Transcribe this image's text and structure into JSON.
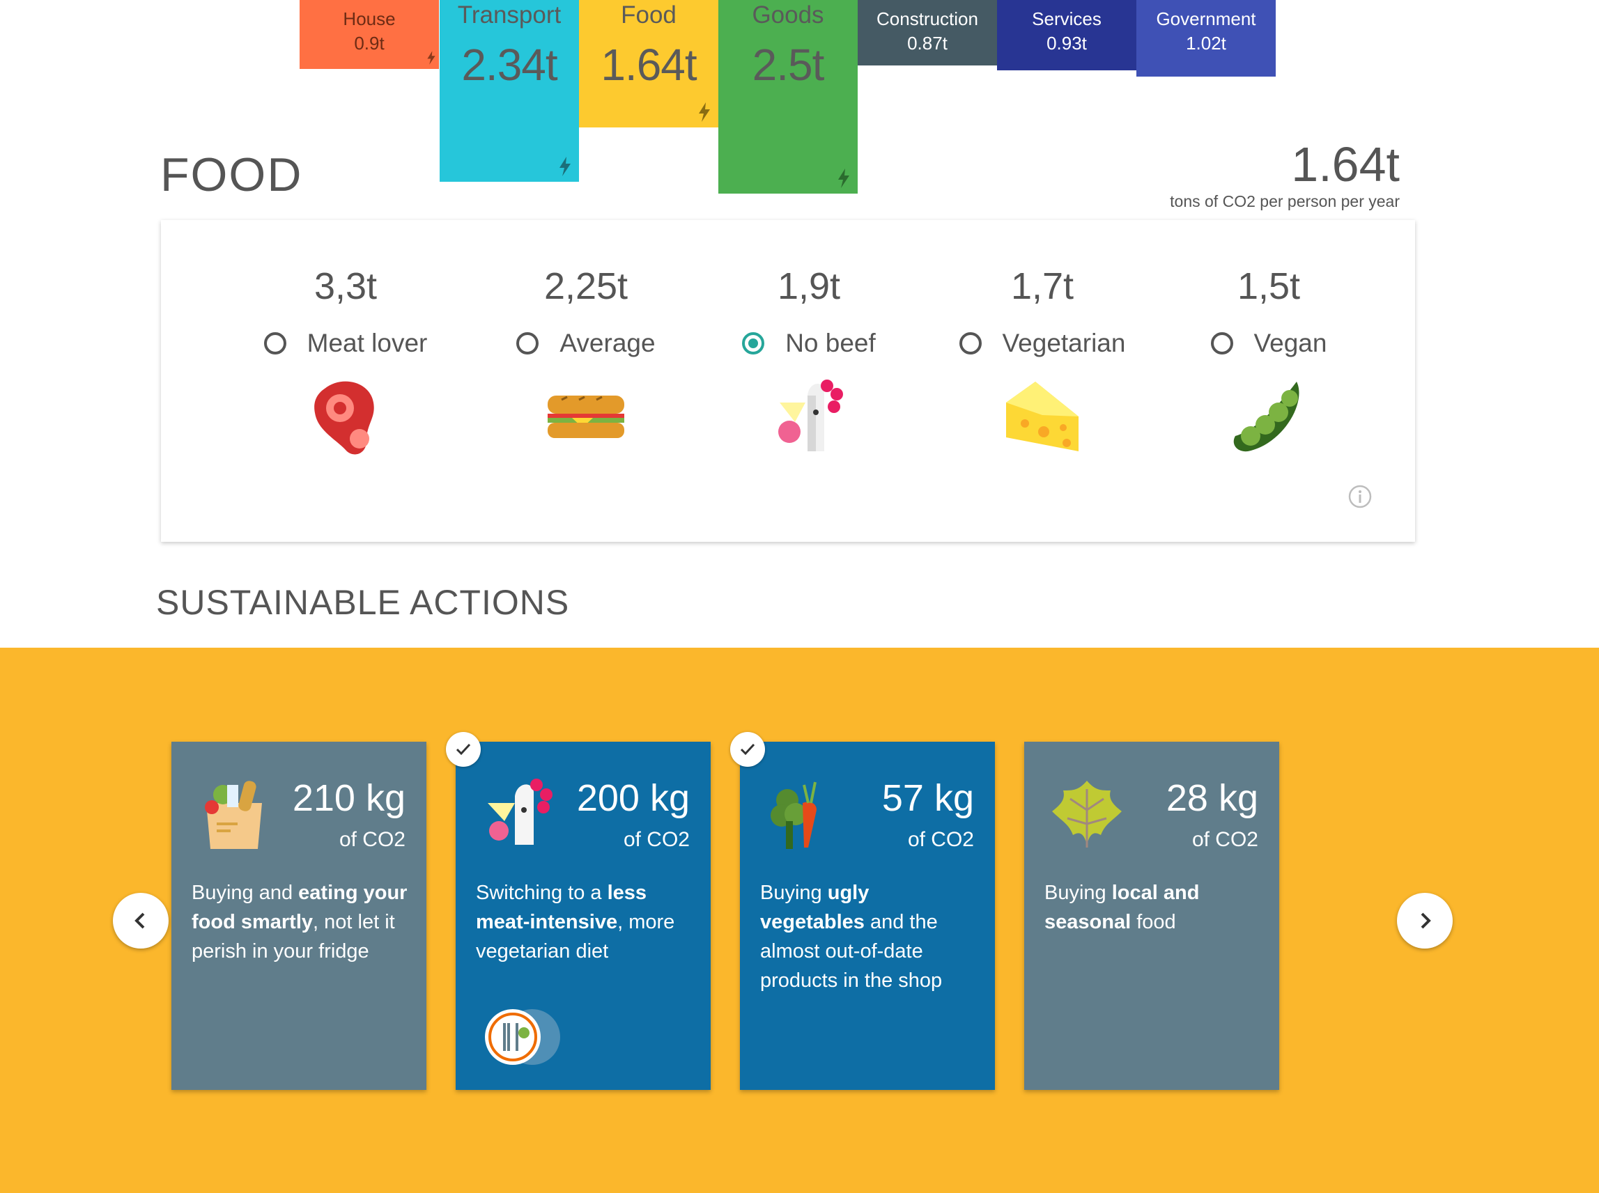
{
  "categories": [
    {
      "id": "house",
      "name": "House",
      "value": "0.9t"
    },
    {
      "id": "transport",
      "name": "Transport",
      "value": "2.34t"
    },
    {
      "id": "food",
      "name": "Food",
      "value": "1.64t"
    },
    {
      "id": "goods",
      "name": "Goods",
      "value": "2.5t"
    },
    {
      "id": "construction",
      "name": "Construction",
      "value": "0.87t"
    },
    {
      "id": "services",
      "name": "Services",
      "value": "0.93t"
    },
    {
      "id": "government",
      "name": "Government",
      "value": "1.02t"
    }
  ],
  "section": {
    "title": "FOOD",
    "total_value": "1.64t",
    "total_unit": "tons of CO2 per person per year"
  },
  "diets": [
    {
      "amount": "3,3t",
      "label": "Meat lover",
      "selected": false,
      "icon": "steak-icon"
    },
    {
      "amount": "2,25t",
      "label": "Average",
      "selected": false,
      "icon": "sandwich-icon"
    },
    {
      "amount": "1,9t",
      "label": "No beef",
      "selected": true,
      "icon": "chicken-icon"
    },
    {
      "amount": "1,7t",
      "label": "Vegetarian",
      "selected": false,
      "icon": "cheese-icon"
    },
    {
      "amount": "1,5t",
      "label": "Vegan",
      "selected": false,
      "icon": "peas-icon"
    }
  ],
  "actions_title": "SUSTAINABLE ACTIONS",
  "actions": [
    {
      "amount": "210 kg",
      "unit": "of CO2",
      "pre": "Buying and ",
      "bold": "eating your food smartly",
      "post": ", not let it perish in your fridge",
      "checked": false,
      "icon": "grocery-bag-icon"
    },
    {
      "amount": "200 kg",
      "unit": "of CO2",
      "pre": "Switching to a ",
      "bold": "less meat-intensive",
      "post": ", more vegetarian diet",
      "checked": true,
      "icon": "chicken-icon"
    },
    {
      "amount": "57 kg",
      "unit": "of CO2",
      "pre": "Buying ",
      "bold": "ugly vegetables",
      "post": " and the almost out-of-date products in the shop",
      "checked": true,
      "icon": "vegetables-icon"
    },
    {
      "amount": "28 kg",
      "unit": "of CO2",
      "pre": "Buying ",
      "bold": "local and seasonal",
      "post": " food",
      "checked": false,
      "icon": "leaf-icon"
    }
  ],
  "colors": {
    "house": "#ff7043",
    "transport": "#26c6da",
    "food": "#fdca2f",
    "goods": "#4caf50",
    "construction": "#455a64",
    "services": "#283593",
    "government": "#3f51b5",
    "band": "#fbb72c",
    "card_grey": "#607d8b",
    "card_blue": "#0e6ea5",
    "radio_on": "#26a69a"
  }
}
